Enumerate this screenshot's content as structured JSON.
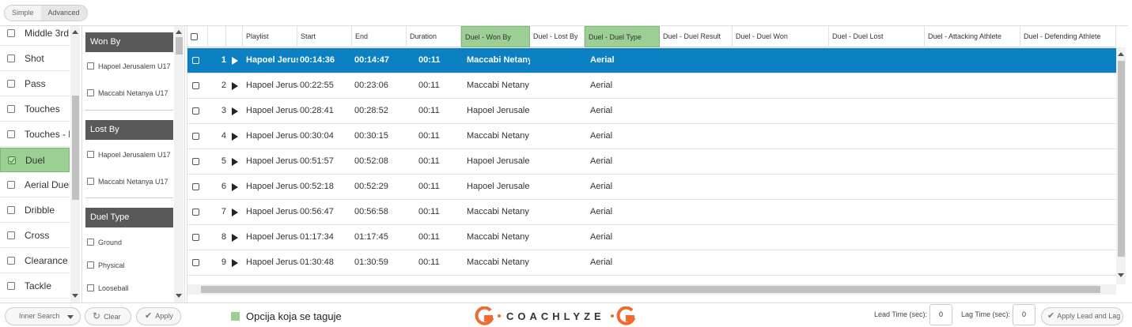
{
  "mode_toggle": {
    "simple": "Simple",
    "advanced": "Advanced"
  },
  "categories": [
    {
      "label": "Middle 3rd",
      "selected": false
    },
    {
      "label": "Shot",
      "selected": false
    },
    {
      "label": "Pass",
      "selected": false
    },
    {
      "label": "Touches",
      "selected": false
    },
    {
      "label": "Touches - le",
      "selected": false
    },
    {
      "label": "Duel",
      "selected": true
    },
    {
      "label": "Aerial Duel",
      "selected": false
    },
    {
      "label": "Dribble",
      "selected": false
    },
    {
      "label": "Cross",
      "selected": false
    },
    {
      "label": "Clearance",
      "selected": false
    },
    {
      "label": "Tackle",
      "selected": false
    }
  ],
  "filters": {
    "won_by": {
      "title": "Won By",
      "options": [
        "Hapoel Jerusalem U17",
        "Maccabi Netanya U17"
      ]
    },
    "lost_by": {
      "title": "Lost By",
      "options": [
        "Hapoel Jerusalem U17",
        "Maccabi Netanya U17"
      ]
    },
    "duel_type": {
      "title": "Duel Type",
      "options": [
        "Ground",
        "Physical",
        "Looseball"
      ]
    }
  },
  "grid": {
    "columns": [
      "Playlist",
      "Start",
      "End",
      "Duration",
      "Duel - Won By",
      "Duel - Lost By",
      "Duel - Duel Type",
      "Duel - Duel Result",
      "Duel - Duel Won",
      "Duel - Duel Lost",
      "Duel - Attacking Athlete",
      "Duel - Defending Athlete"
    ],
    "highlighted_columns": [
      "Duel - Won By",
      "Duel - Duel Type"
    ],
    "rows": [
      {
        "n": "1",
        "playlist": "Hapoel Jerusalem",
        "start": "00:14:36",
        "end": "00:14:47",
        "duration": "00:11",
        "won_by": "Maccabi Netany",
        "duel_type": "Aerial",
        "active": true
      },
      {
        "n": "2",
        "playlist": "Hapoel Jerusalem",
        "start": "00:22:55",
        "end": "00:23:06",
        "duration": "00:11",
        "won_by": "Maccabi Netany",
        "duel_type": "Aerial",
        "active": false
      },
      {
        "n": "3",
        "playlist": "Hapoel Jerusalem",
        "start": "00:28:41",
        "end": "00:28:52",
        "duration": "00:11",
        "won_by": "Hapoel Jerusale",
        "duel_type": "Aerial",
        "active": false
      },
      {
        "n": "4",
        "playlist": "Hapoel Jerusalem",
        "start": "00:30:04",
        "end": "00:30:15",
        "duration": "00:11",
        "won_by": "Maccabi Netany",
        "duel_type": "Aerial",
        "active": false
      },
      {
        "n": "5",
        "playlist": "Hapoel Jerusalem",
        "start": "00:51:57",
        "end": "00:52:08",
        "duration": "00:11",
        "won_by": "Hapoel Jerusale",
        "duel_type": "Aerial",
        "active": false
      },
      {
        "n": "6",
        "playlist": "Hapoel Jerusalem",
        "start": "00:52:18",
        "end": "00:52:29",
        "duration": "00:11",
        "won_by": "Hapoel Jerusale",
        "duel_type": "Aerial",
        "active": false
      },
      {
        "n": "7",
        "playlist": "Hapoel Jerusalem",
        "start": "00:56:47",
        "end": "00:56:58",
        "duration": "00:11",
        "won_by": "Maccabi Netany",
        "duel_type": "Aerial",
        "active": false
      },
      {
        "n": "8",
        "playlist": "Hapoel Jerusalem",
        "start": "01:17:34",
        "end": "01:17:45",
        "duration": "00:11",
        "won_by": "Maccabi Netany",
        "duel_type": "Aerial",
        "active": false
      },
      {
        "n": "9",
        "playlist": "Hapoel Jerusalem",
        "start": "01:30:48",
        "end": "01:30:59",
        "duration": "00:11",
        "won_by": "Maccabi Netany",
        "duel_type": "Aerial",
        "active": false
      }
    ]
  },
  "bottom": {
    "inner_search": "Inner Search",
    "clear": "Clear",
    "apply": "Apply",
    "legend": "Opcija koja se taguje",
    "logo_text": "COACHLYZE",
    "lead_time_label": "Lead Time (sec):",
    "lead_time_value": "0",
    "lag_time_label": "Lag Time (sec):",
    "lag_time_value": "0",
    "apply_lead_lag": "Apply Lead and Lag"
  },
  "colors": {
    "highlight": "#9ccf94",
    "active_row": "#0b80c2",
    "filter_header": "#595959",
    "logo_accent": "#f26a2e"
  }
}
